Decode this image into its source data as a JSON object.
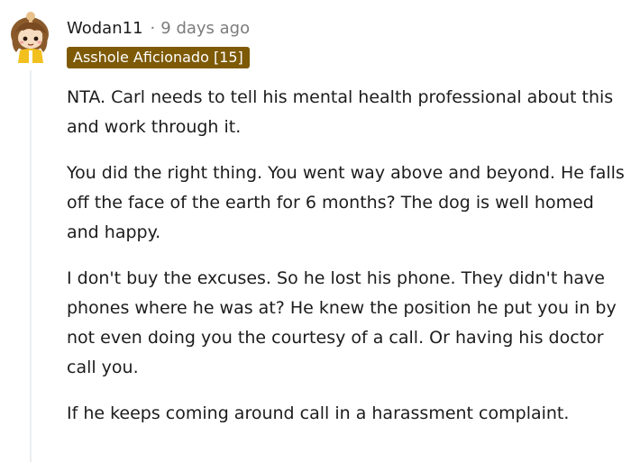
{
  "comment": {
    "author": "Wodan11",
    "separator": "·",
    "timestamp": "9 days ago",
    "flair": "Asshole Aficionado [15]",
    "paragraphs": [
      "NTA. Carl needs to tell his mental health professional about this and work through it.",
      "You did the right thing. You went way above and beyond. He falls off the face of the earth for 6 months? The dog is well homed and happy.",
      "I don't buy the excuses. So he lost his phone. They didn't have phones where he was at? He knew the position he put you in by not even doing you the courtesy of a call. Or having his doctor call you.",
      "If he keeps coming around call in a harassment complaint."
    ]
  },
  "colors": {
    "flair_background": "#7e5a06",
    "flair_text": "#ffffff",
    "meta_text": "#7c7c7c",
    "body_text": "#1c1c1c",
    "thread_line": "#ebeef0"
  },
  "icons": {
    "avatar": "snoo-avatar-icon"
  }
}
